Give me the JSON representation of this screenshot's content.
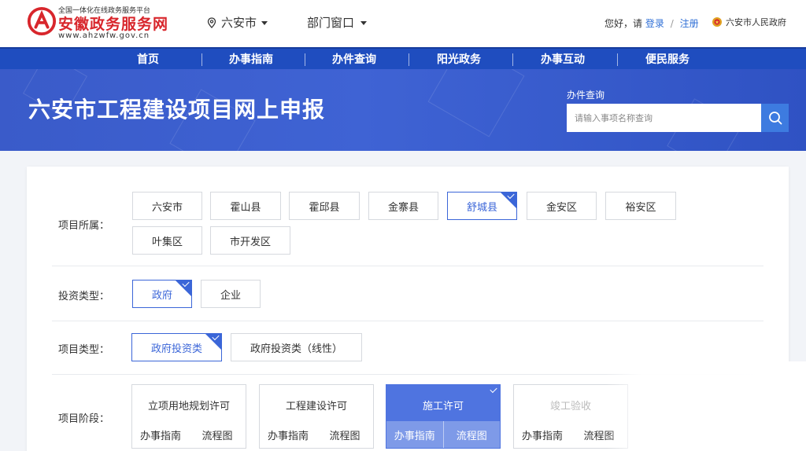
{
  "header": {
    "logo_sub": "全国一体化在线政务服务平台",
    "logo_title": "安徽政务服务网",
    "logo_url": "www.ahzwfw.gov.cn",
    "location": "六安市",
    "department": "部门窗口",
    "greeting": "您好，请",
    "login": "登录",
    "separator": "/",
    "register": "注册",
    "gov_name": "六安市人民政府"
  },
  "nav": {
    "items": [
      "首页",
      "办事指南",
      "办件查询",
      "阳光政务",
      "办事互动",
      "便民服务"
    ]
  },
  "banner": {
    "title": "六安市工程建设项目网上申报",
    "search_label": "办件查询",
    "search_placeholder": "请输入事项名称查询"
  },
  "filters": {
    "region": {
      "label": "项目所属：",
      "options": [
        "六安市",
        "霍山县",
        "霍邱县",
        "金寨县",
        "舒城县",
        "金安区",
        "裕安区",
        "叶集区",
        "市开发区"
      ],
      "selected": "舒城县"
    },
    "investment": {
      "label": "投资类型：",
      "options": [
        "政府",
        "企业"
      ],
      "selected": "政府"
    },
    "project_type": {
      "label": "项目类型：",
      "options": [
        "政府投资类",
        "政府投资类（线性）"
      ],
      "selected": "政府投资类"
    },
    "stage": {
      "label": "项目阶段：",
      "stages": [
        {
          "title": "立项用地规划许可",
          "guide": "办事指南",
          "flow": "流程图"
        },
        {
          "title": "工程建设许可",
          "guide": "办事指南",
          "flow": "流程图"
        },
        {
          "title": "施工许可",
          "guide": "办事指南",
          "flow": "流程图"
        },
        {
          "title": "竣工验收",
          "guide": "办事指南",
          "flow": "流程图"
        }
      ],
      "selected": "施工许可"
    }
  },
  "colors": {
    "brand_red": "#d8262c",
    "nav_blue": "#1f4dbf",
    "accent": "#3b66d8"
  }
}
